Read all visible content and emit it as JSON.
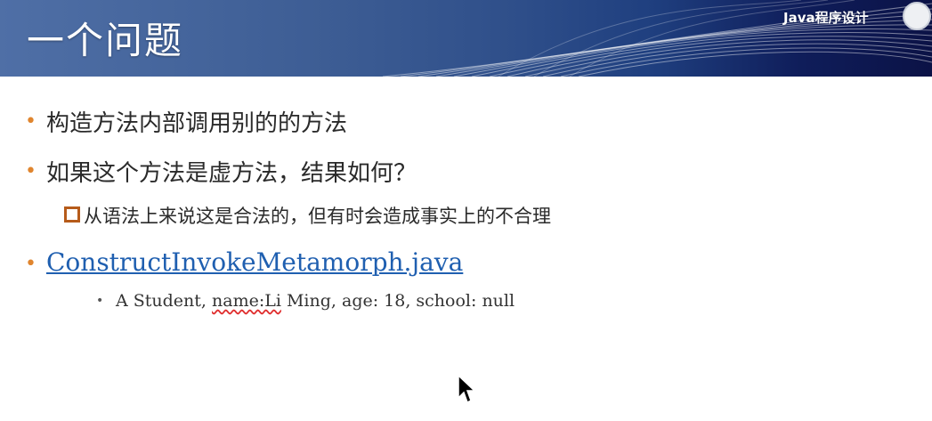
{
  "slide": {
    "title": "一个问题",
    "brand": "Java程序设计",
    "bullets": [
      "构造方法内部调用别的的方法",
      "如果这个方法是虚方法，结果如何？"
    ],
    "sub_bullet": "从语法上来说这是合法的，但有时会造成事实上的不合理",
    "link": "ConstructInvokeMetamorph.java",
    "output": {
      "prefix": "A Student, ",
      "squiggle": "name:Li",
      "suffix": " Ming, age: 18, school: null"
    }
  },
  "colors": {
    "bullet": "#e0852e",
    "link": "#1f5fb0",
    "sub_marker": "#b65b1a"
  }
}
